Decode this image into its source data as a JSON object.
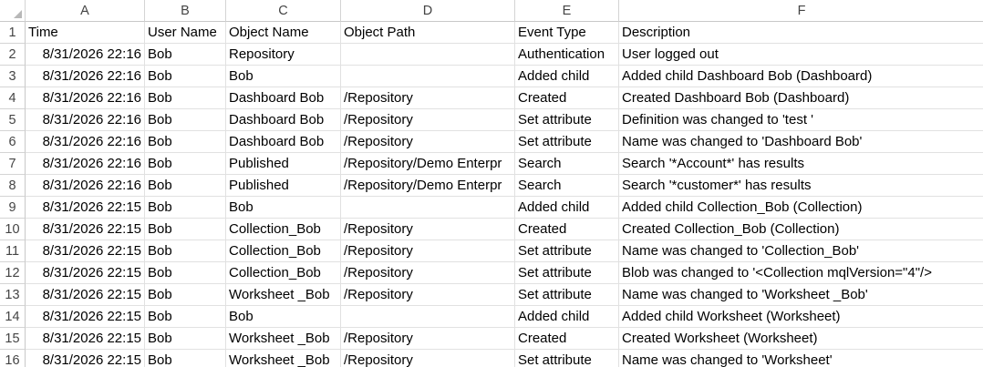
{
  "columns": [
    "A",
    "B",
    "C",
    "D",
    "E",
    "F"
  ],
  "rows": [
    {
      "num": "1",
      "cells": [
        "Time",
        "User Name",
        "Object Name",
        "Object Path",
        "Event Type",
        "Description"
      ]
    },
    {
      "num": "2",
      "cells": [
        "8/31/2026 22:16",
        "Bob",
        "Repository",
        "",
        "Authentication",
        "User logged out"
      ]
    },
    {
      "num": "3",
      "cells": [
        "8/31/2026 22:16",
        "Bob",
        "Bob",
        "",
        "Added child",
        "Added child Dashboard Bob (Dashboard)"
      ]
    },
    {
      "num": "4",
      "cells": [
        "8/31/2026 22:16",
        "Bob",
        "Dashboard Bob",
        "/Repository",
        "Created",
        "Created Dashboard Bob (Dashboard)"
      ]
    },
    {
      "num": "5",
      "cells": [
        "8/31/2026 22:16",
        "Bob",
        "Dashboard Bob",
        "/Repository",
        "Set attribute",
        "Definition was changed to 'test '"
      ]
    },
    {
      "num": "6",
      "cells": [
        "8/31/2026 22:16",
        "Bob",
        "Dashboard Bob",
        "/Repository",
        "Set attribute",
        "Name was changed to 'Dashboard Bob'"
      ]
    },
    {
      "num": "7",
      "cells": [
        "8/31/2026 22:16",
        "Bob",
        "Published",
        "/Repository/Demo Enterpr",
        "Search",
        "Search '*Account*' has results"
      ]
    },
    {
      "num": "8",
      "cells": [
        "8/31/2026 22:16",
        "Bob",
        "Published",
        "/Repository/Demo Enterpr",
        "Search",
        "Search '*customer*' has results"
      ]
    },
    {
      "num": "9",
      "cells": [
        "8/31/2026 22:15",
        "Bob",
        "Bob",
        "",
        "Added child",
        "Added child Collection_Bob (Collection)"
      ]
    },
    {
      "num": "10",
      "cells": [
        "8/31/2026 22:15",
        "Bob",
        "Collection_Bob",
        "/Repository",
        "Created",
        "Created Collection_Bob (Collection)"
      ]
    },
    {
      "num": "11",
      "cells": [
        "8/31/2026 22:15",
        "Bob",
        "Collection_Bob",
        "/Repository",
        "Set attribute",
        "Name was changed to 'Collection_Bob'"
      ]
    },
    {
      "num": "12",
      "cells": [
        "8/31/2026 22:15",
        "Bob",
        "Collection_Bob",
        "/Repository",
        "Set attribute",
        "Blob was changed to '<Collection mqlVersion=\"4\"/>"
      ]
    },
    {
      "num": "13",
      "cells": [
        "8/31/2026 22:15",
        "Bob",
        "Worksheet _Bob",
        "/Repository",
        "Set attribute",
        "Name was changed to 'Worksheet _Bob'"
      ]
    },
    {
      "num": "14",
      "cells": [
        "8/31/2026 22:15",
        "Bob",
        "Bob",
        "",
        "Added child",
        "Added child Worksheet (Worksheet)"
      ]
    },
    {
      "num": "15",
      "cells": [
        "8/31/2026 22:15",
        "Bob",
        "Worksheet _Bob",
        "/Repository",
        "Created",
        "Created Worksheet (Worksheet)"
      ]
    },
    {
      "num": "16",
      "cells": [
        "8/31/2026 22:15",
        "Bob",
        "Worksheet _Bob",
        "/Repository",
        "Set attribute",
        "Name was changed to 'Worksheet'"
      ]
    }
  ]
}
